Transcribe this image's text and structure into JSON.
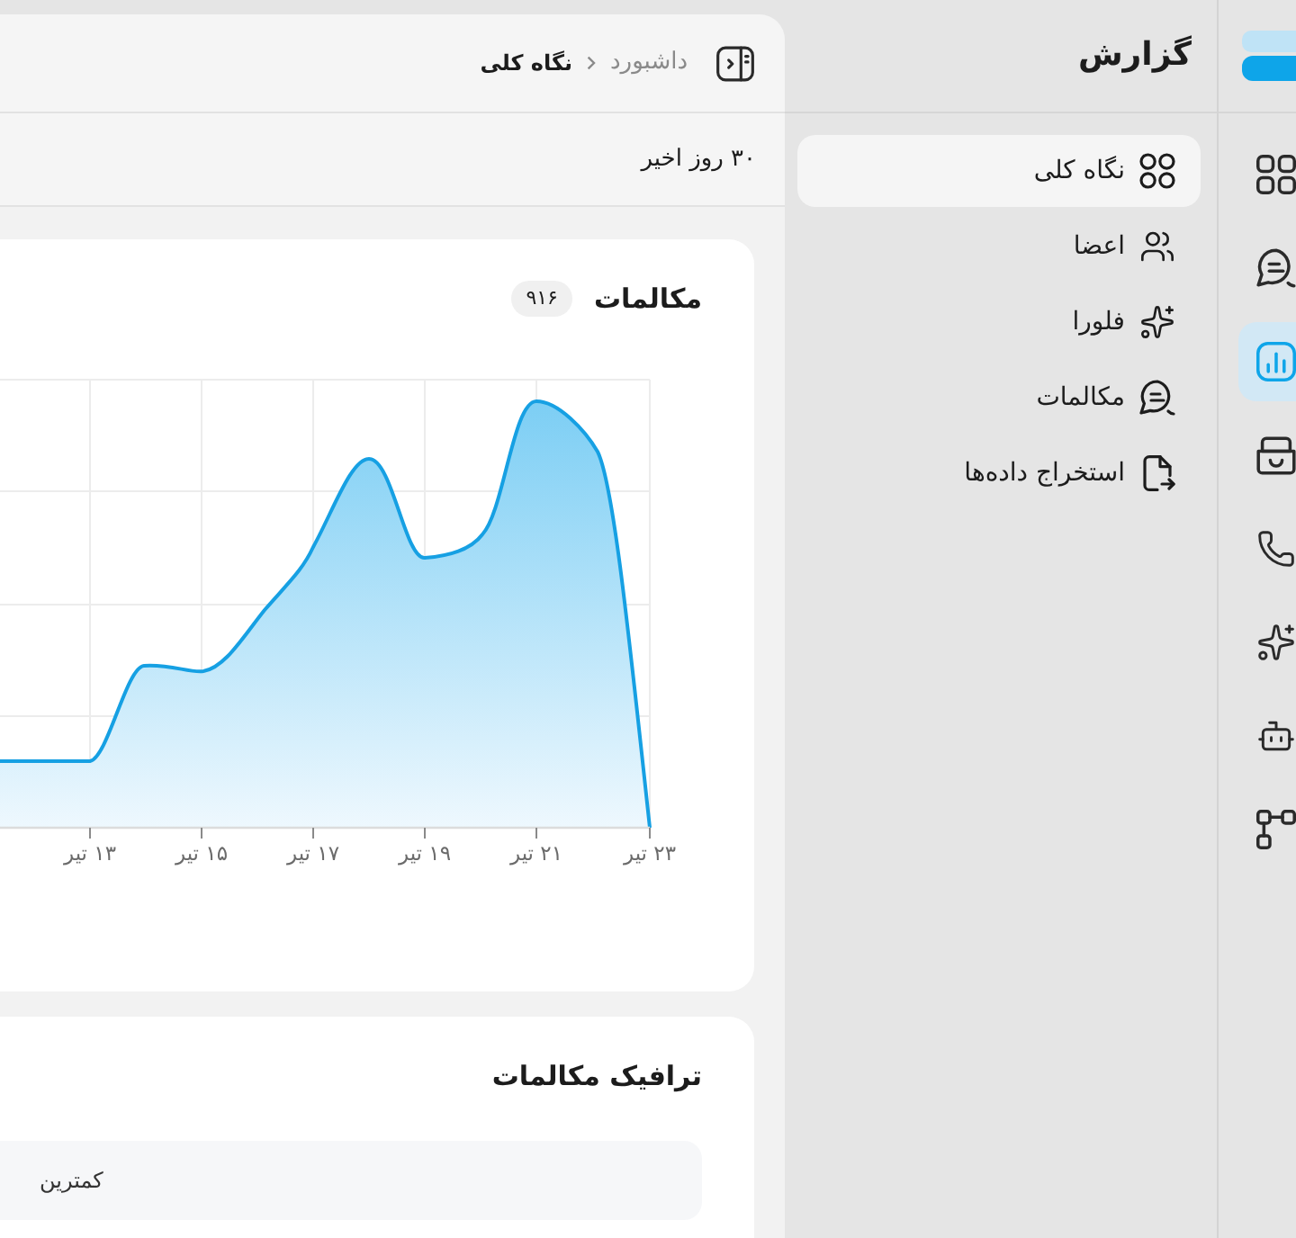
{
  "rail": {
    "items": [
      {
        "selected": false
      },
      {
        "selected": false
      },
      {
        "selected": true
      },
      {
        "selected": false
      },
      {
        "selected": false
      },
      {
        "selected": false
      },
      {
        "selected": false
      },
      {
        "selected": false
      }
    ]
  },
  "sidebar": {
    "title": "گزارش",
    "items": [
      {
        "label": "نگاه کلی",
        "selected": true
      },
      {
        "label": "اعضا",
        "selected": false
      },
      {
        "label": "فلورا",
        "selected": false
      },
      {
        "label": "مکالمات",
        "selected": false
      },
      {
        "label": "استخراج داده‌ها",
        "selected": false
      }
    ]
  },
  "header": {
    "breadcrumb": [
      {
        "label": "داشبورد",
        "current": false
      },
      {
        "label": "نگاه کلی",
        "current": true
      }
    ]
  },
  "date_range": "۳۰ روز اخیر",
  "calls_card": {
    "title": "مکالمات",
    "count": "۹۱۶",
    "x_labels": [
      "۲۳ تیر",
      "۲۱ تیر",
      "۱۹ تیر",
      "۱۷ تیر",
      "۱۵ تیر",
      "۱۳ تیر"
    ]
  },
  "traffic_card": {
    "title": "ترافیک مکالمات",
    "legend": {
      "label": "کمترین"
    }
  }
}
